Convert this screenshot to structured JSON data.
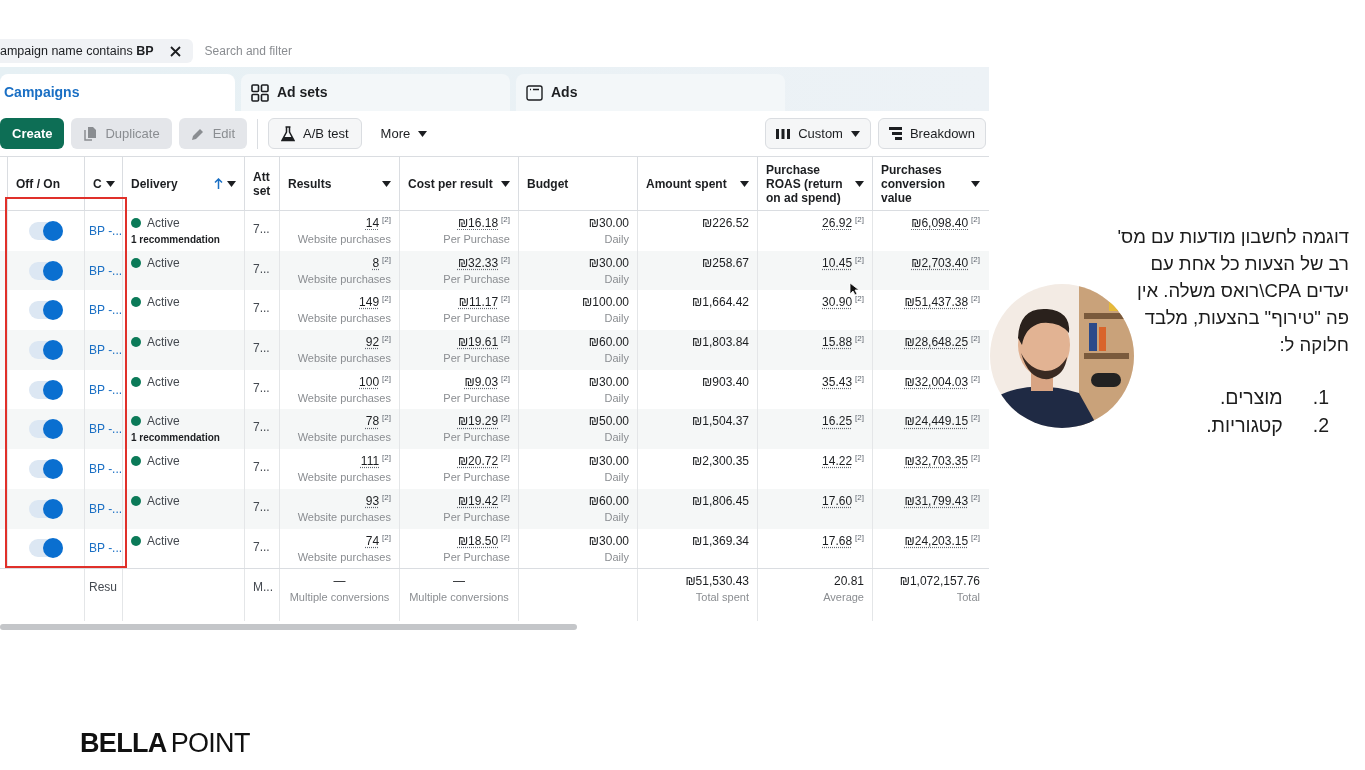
{
  "filter": {
    "chip": "ampaign name contains **BP**",
    "placeholder": "Search and filter"
  },
  "tabs": [
    {
      "label": "Campaigns",
      "kind": "campaigns",
      "selected": true
    },
    {
      "label": "Ad sets",
      "kind": "adsets",
      "selected": false
    },
    {
      "label": "Ads",
      "kind": "ads",
      "selected": false
    }
  ],
  "toolbar": {
    "left": [
      {
        "label": "Create",
        "kind": "primary",
        "disabled": false
      },
      {
        "label": "Duplicate",
        "kind": "duplicate",
        "disabled": true
      },
      {
        "label": "Edit",
        "kind": "edit",
        "disabled": true
      },
      {
        "label": "A/B test",
        "kind": "abtest",
        "disabled": false
      },
      {
        "label": "More",
        "kind": "more",
        "disabled": false
      }
    ],
    "right": [
      {
        "label": "Custom",
        "kind": "columns"
      },
      {
        "label": "Breakdown",
        "kind": "breakdown"
      }
    ]
  },
  "columns": [
    {
      "label": "Off / On",
      "caret": false,
      "sorted": false
    },
    {
      "label": "C",
      "caret": true,
      "sorted": false
    },
    {
      "label": "Delivery",
      "caret": true,
      "sorted": true
    },
    {
      "label": "Att set",
      "caret": false,
      "sorted": false
    },
    {
      "label": "Results",
      "caret": true,
      "sorted": false
    },
    {
      "label": "Cost per result",
      "caret": true,
      "sorted": false
    },
    {
      "label": "Budget",
      "caret": false,
      "sorted": false
    },
    {
      "label": "Amount spent",
      "caret": true,
      "sorted": false
    },
    {
      "label": "Purchase ROAS (return on ad spend)",
      "caret": true,
      "sorted": false
    },
    {
      "label": "Purchases conversion value",
      "caret": true,
      "sorted": false
    }
  ],
  "rows": [
    {
      "on": true,
      "name": "BP -...",
      "status": "Active",
      "recommendation": "1 recommendation",
      "attribution": "7...",
      "results": {
        "value": "14",
        "note": "[2]",
        "label": "Website purchases"
      },
      "cost": {
        "value": "₪16.18",
        "note": "[2]",
        "label": "Per Purchase"
      },
      "budget": {
        "value": "₪30.00",
        "label": "Daily"
      },
      "spent": {
        "value": "₪226.52"
      },
      "roas": {
        "value": "26.92",
        "note": "[2]"
      },
      "conv": {
        "value": "₪6,098.40",
        "note": "[2]"
      }
    },
    {
      "on": true,
      "name": "BP -...",
      "status": "Active",
      "attribution": "7...",
      "results": {
        "value": "8",
        "note": "[2]",
        "label": "Website purchases"
      },
      "cost": {
        "value": "₪32.33",
        "note": "[2]",
        "label": "Per Purchase"
      },
      "budget": {
        "value": "₪30.00",
        "label": "Daily"
      },
      "spent": {
        "value": "₪258.67"
      },
      "roas": {
        "value": "10.45",
        "note": "[2]"
      },
      "conv": {
        "value": "₪2,703.40",
        "note": "[2]"
      }
    },
    {
      "on": true,
      "name": "BP -...",
      "status": "Active",
      "attribution": "7...",
      "results": {
        "value": "149",
        "note": "[2]",
        "label": "Website purchases"
      },
      "cost": {
        "value": "₪11.17",
        "note": "[2]",
        "label": "Per Purchase"
      },
      "budget": {
        "value": "₪100.00",
        "label": "Daily"
      },
      "spent": {
        "value": "₪1,664.42"
      },
      "roas": {
        "value": "30.90",
        "note": "[2]"
      },
      "conv": {
        "value": "₪51,437.38",
        "note": "[2]"
      }
    },
    {
      "on": true,
      "name": "BP -...",
      "status": "Active",
      "attribution": "7...",
      "results": {
        "value": "92",
        "note": "[2]",
        "label": "Website purchases"
      },
      "cost": {
        "value": "₪19.61",
        "note": "[2]",
        "label": "Per Purchase"
      },
      "budget": {
        "value": "₪60.00",
        "label": "Daily"
      },
      "spent": {
        "value": "₪1,803.84"
      },
      "roas": {
        "value": "15.88",
        "note": "[2]"
      },
      "conv": {
        "value": "₪28,648.25",
        "note": "[2]"
      }
    },
    {
      "on": true,
      "name": "BP -...",
      "status": "Active",
      "attribution": "7...",
      "results": {
        "value": "100",
        "note": "[2]",
        "label": "Website purchases"
      },
      "cost": {
        "value": "₪9.03",
        "note": "[2]",
        "label": "Per Purchase"
      },
      "budget": {
        "value": "₪30.00",
        "label": "Daily"
      },
      "spent": {
        "value": "₪903.40"
      },
      "roas": {
        "value": "35.43",
        "note": "[2]"
      },
      "conv": {
        "value": "₪32,004.03",
        "note": "[2]"
      }
    },
    {
      "on": true,
      "name": "BP -...",
      "status": "Active",
      "recommendation": "1 recommendation",
      "attribution": "7...",
      "results": {
        "value": "78",
        "note": "[2]",
        "label": "Website purchases"
      },
      "cost": {
        "value": "₪19.29",
        "note": "[2]",
        "label": "Per Purchase"
      },
      "budget": {
        "value": "₪50.00",
        "label": "Daily"
      },
      "spent": {
        "value": "₪1,504.37"
      },
      "roas": {
        "value": "16.25",
        "note": "[2]"
      },
      "conv": {
        "value": "₪24,449.15",
        "note": "[2]"
      }
    },
    {
      "on": true,
      "name": "BP -...",
      "status": "Active",
      "attribution": "7...",
      "results": {
        "value": "111",
        "note": "[2]",
        "label": "Website purchases"
      },
      "cost": {
        "value": "₪20.72",
        "note": "[2]",
        "label": "Per Purchase"
      },
      "budget": {
        "value": "₪30.00",
        "label": "Daily"
      },
      "spent": {
        "value": "₪2,300.35"
      },
      "roas": {
        "value": "14.22",
        "note": "[2]"
      },
      "conv": {
        "value": "₪32,703.35",
        "note": "[2]"
      }
    },
    {
      "on": true,
      "name": "BP -...",
      "status": "Active",
      "attribution": "7...",
      "results": {
        "value": "93",
        "note": "[2]",
        "label": "Website purchases"
      },
      "cost": {
        "value": "₪19.42",
        "note": "[2]",
        "label": "Per Purchase"
      },
      "budget": {
        "value": "₪60.00",
        "label": "Daily"
      },
      "spent": {
        "value": "₪1,806.45"
      },
      "roas": {
        "value": "17.60",
        "note": "[2]"
      },
      "conv": {
        "value": "₪31,799.43",
        "note": "[2]"
      }
    },
    {
      "on": true,
      "name": "BP -...",
      "status": "Active",
      "attribution": "7...",
      "results": {
        "value": "74",
        "note": "[2]",
        "label": "Website purchases"
      },
      "cost": {
        "value": "₪18.50",
        "note": "[2]",
        "label": "Per Purchase"
      },
      "budget": {
        "value": "₪30.00",
        "label": "Daily"
      },
      "spent": {
        "value": "₪1,369.34"
      },
      "roas": {
        "value": "17.68",
        "note": "[2]"
      },
      "conv": {
        "value": "₪24,203.15",
        "note": "[2]"
      }
    }
  ],
  "totals": {
    "name": "Resu",
    "attribution": "M...",
    "results": {
      "value": "—",
      "label": "Multiple conversions"
    },
    "cost": {
      "value": "—",
      "label": "Multiple conversions"
    },
    "spent": {
      "value": "₪51,530.43",
      "label": "Total spent"
    },
    "roas": {
      "value": "20.81",
      "label": "Average"
    },
    "conv": {
      "value": "₪1,072,157.76",
      "label": "Total"
    }
  },
  "note": {
    "text": "דוגמה לחשבון מודעות עם מס' רב של הצעות כל אחת עם יעדים CPA\\רואס משלה. אין פה \"טירוף\" בהצעות, מלבד חלוקה ל:",
    "list": [
      {
        "number": "1.",
        "text": "מוצרים."
      },
      {
        "number": "2.",
        "text": "קטגוריות."
      }
    ]
  },
  "logo": {
    "bold": "BELLA",
    "light": "POINT"
  }
}
